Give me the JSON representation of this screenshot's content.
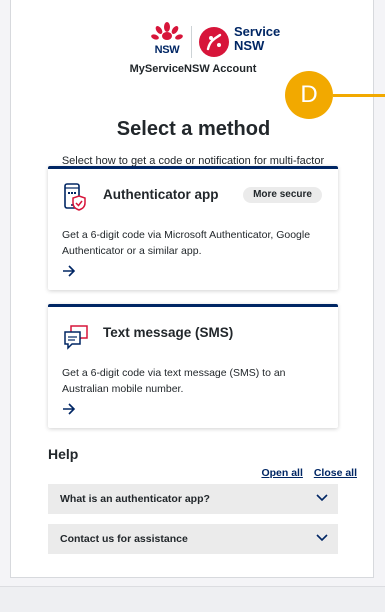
{
  "header": {
    "gov_logo_text": "NSW",
    "brand_line1": "Service",
    "brand_line2": "NSW",
    "account_label": "MyServiceNSW Account",
    "avatar_initial": "D"
  },
  "page": {
    "title": "Select a method",
    "description": "Select how to get a code or notification for multi-factor authentication each time you log in."
  },
  "methods": [
    {
      "title": "Authenticator app",
      "badge": "More secure",
      "description": "Get a 6-digit code via Microsoft Authenticator, Google Authenticator or a similar app.",
      "icon": "phone-shield-icon"
    },
    {
      "title": "Text message (SMS)",
      "description": "Get a 6-digit code via text message (SMS) to an Australian mobile number.",
      "icon": "chat-bubbles-icon"
    }
  ],
  "help": {
    "heading": "Help",
    "open_all": "Open all",
    "close_all": "Close all",
    "items": [
      {
        "label": "What is an authenticator app?"
      },
      {
        "label": "Contact us for assistance"
      }
    ]
  },
  "colors": {
    "navy": "#002664",
    "accent_red": "#d7153a",
    "avatar": "#f2a900"
  }
}
